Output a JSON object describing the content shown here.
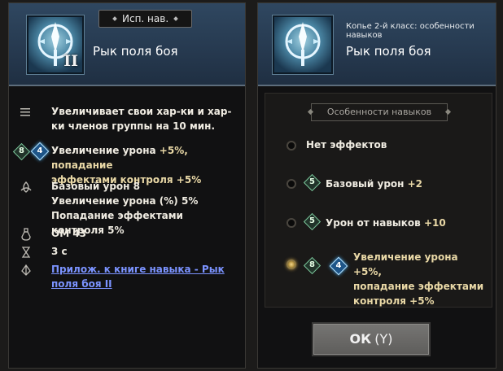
{
  "left": {
    "tag": "Исп. нав.",
    "skill_name": "Рык поля боя",
    "roman": "II",
    "rows": {
      "description": "Увеличивает свои хар-ки и хар-ки членов группы на 10 мин.",
      "effect_badge_green": "8",
      "effect_badge_blue": "4",
      "effect_line1_label": "Увеличение урона ",
      "effect_line1_value": "+5%, попадание",
      "effect_line2": "эффектами контроля +5%",
      "stat1": "Базовый урон  8",
      "stat2": "Увеличение урона (%)  5%",
      "stat3": "Попадание эффектами контроля  5%",
      "cost": "ОМ  43",
      "cooldown": "3 с",
      "link": "Прилож. к книге навыка - Рык поля боя II"
    },
    "icons": [
      "menu-icon",
      "rune-icon",
      "triquetra-icon",
      "potion-icon",
      "hourglass-icon",
      "book-icon"
    ]
  },
  "right": {
    "class_title": "Копье 2-й класс: особенности навыков",
    "skill_name": "Рык поля боя",
    "features_title": "Особенности навыков",
    "options": [
      {
        "text": "Нет эффектов"
      },
      {
        "badge": "5",
        "label": "Базовый урон ",
        "value": "+2"
      },
      {
        "badge": "5",
        "label": "Урон от навыков ",
        "value": "+10"
      },
      {
        "badge_green": "8",
        "badge_blue": "4",
        "line1": "Увеличение урона +5%,",
        "line2": "попадание эффектами",
        "line3": "контроля +5%"
      }
    ],
    "ok_label": "ОК",
    "ok_hotkey": "(Y)"
  },
  "colors": {
    "header_blue": "#2f4760",
    "panel_bg": "#111112",
    "highlight_gold": "#e9d8a6",
    "link_blue": "#7b93ff"
  }
}
